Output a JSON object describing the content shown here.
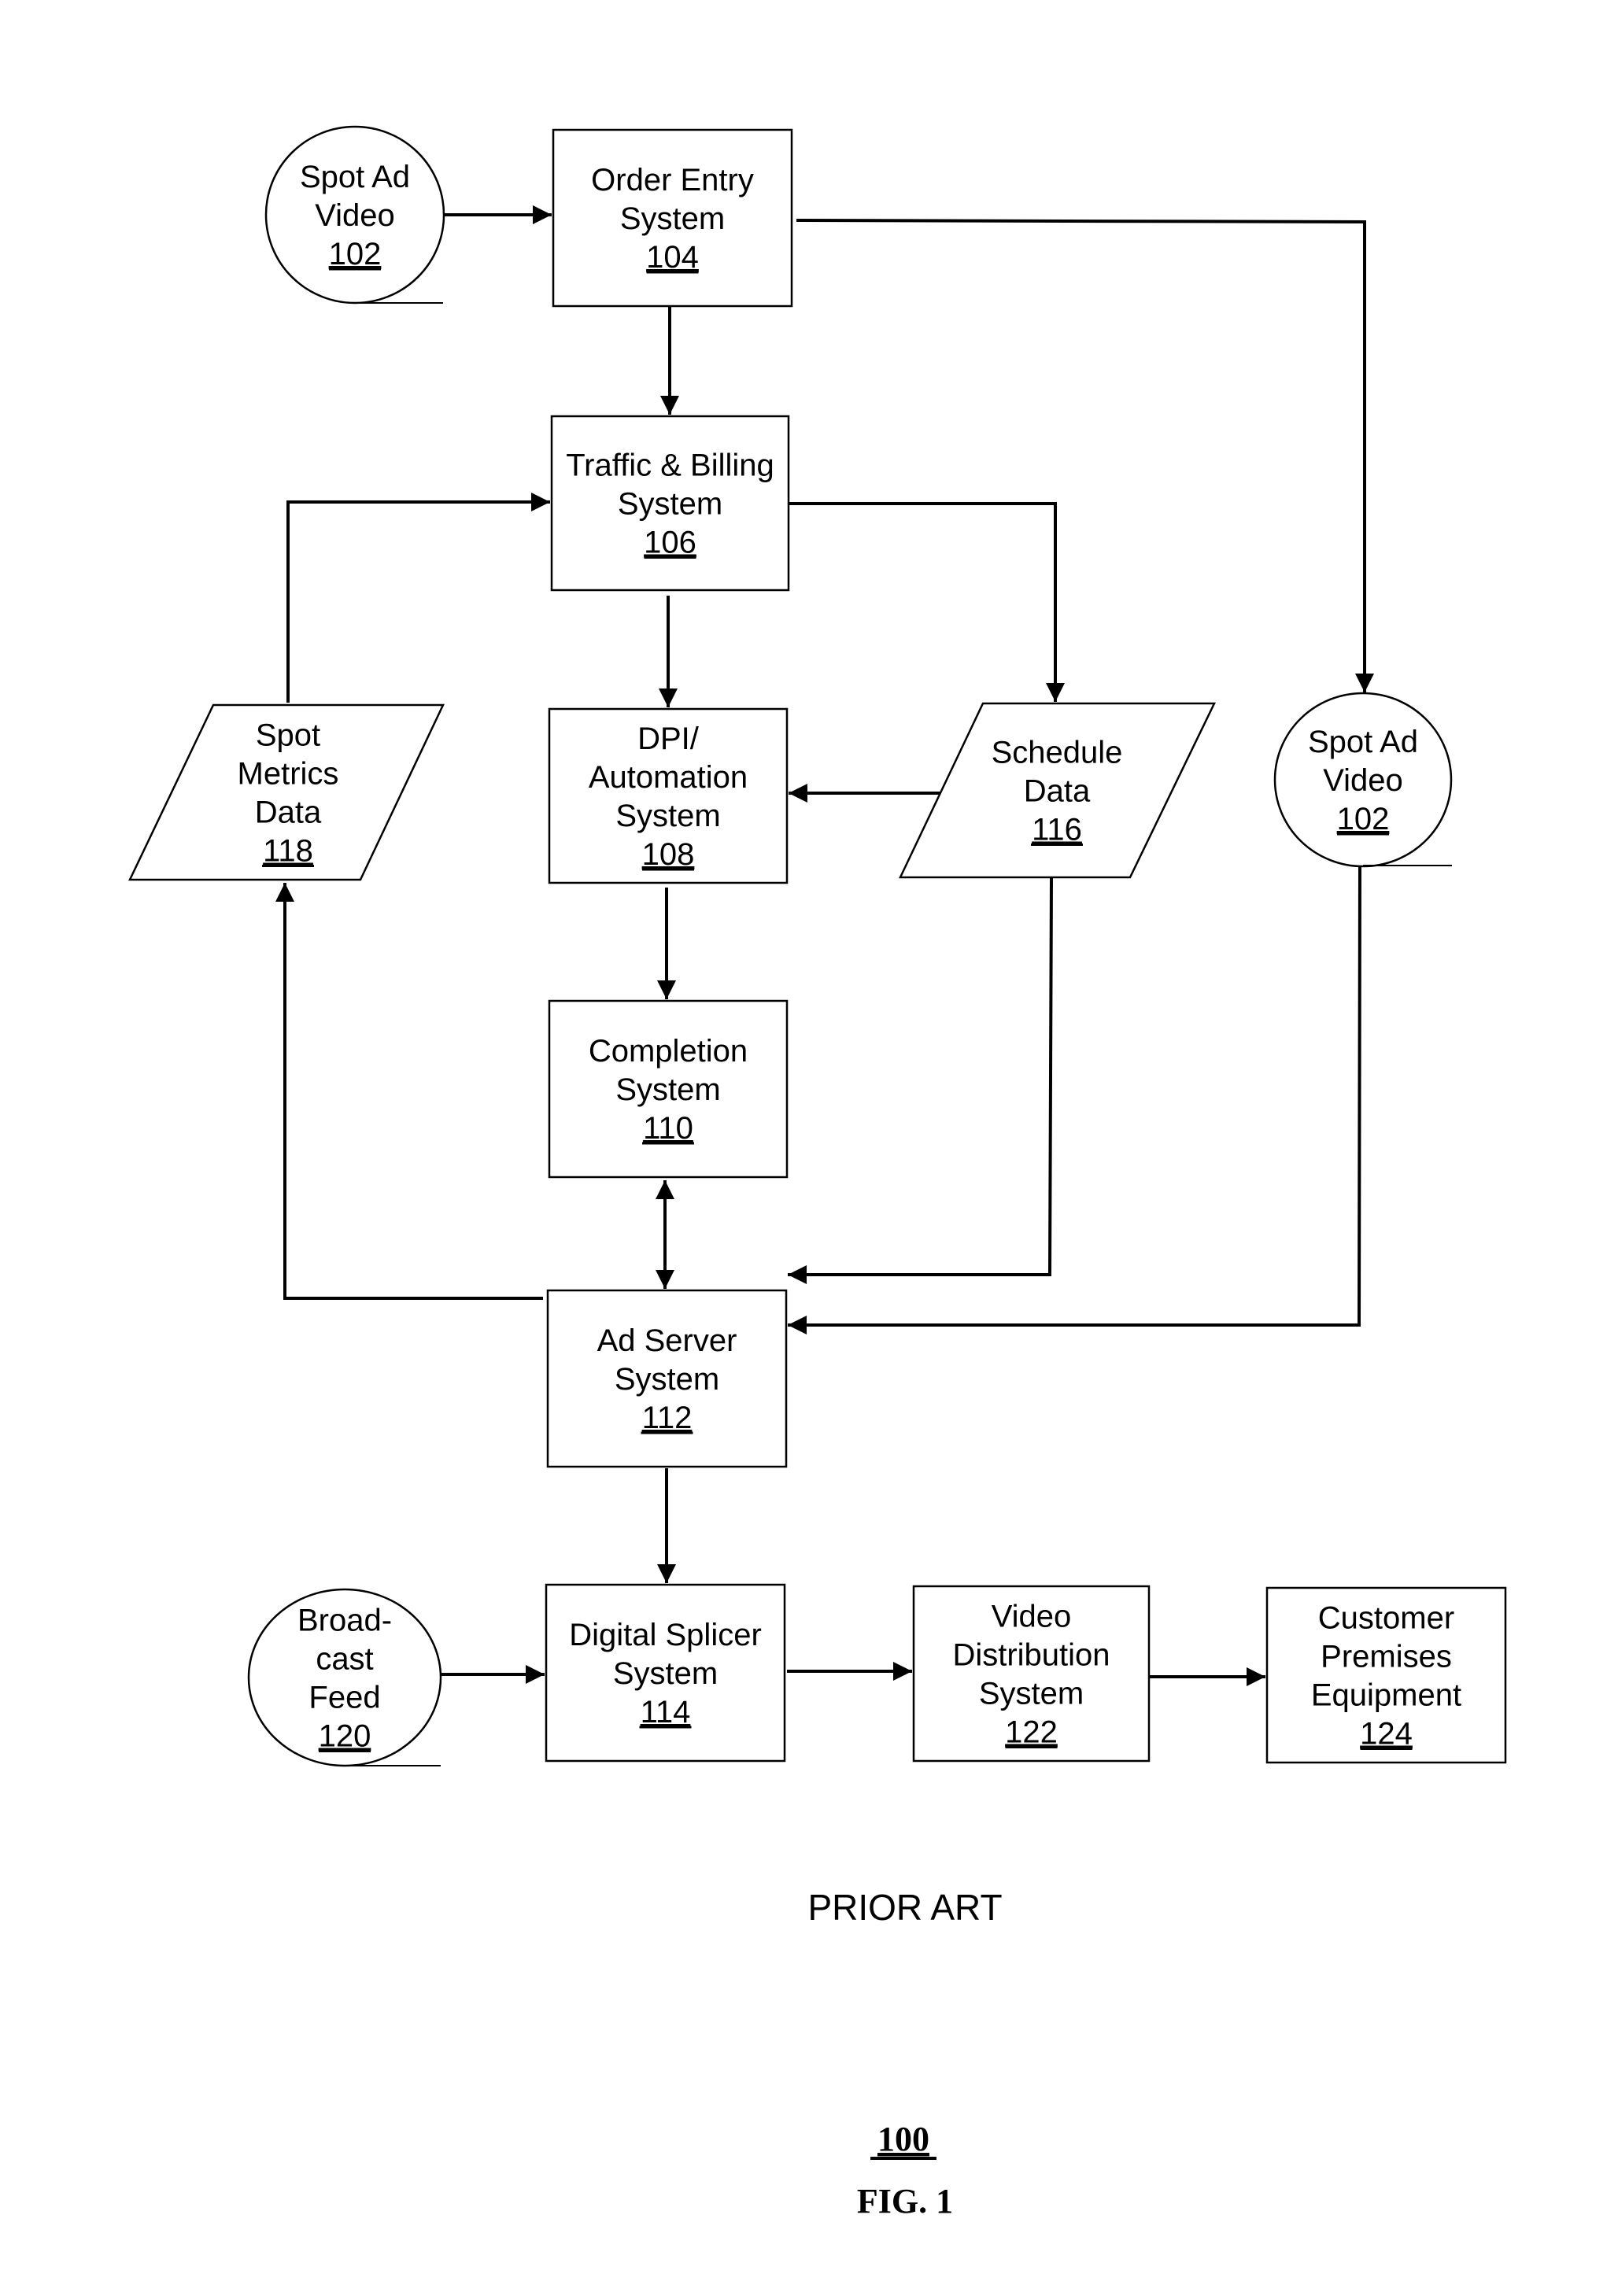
{
  "figure": {
    "caption": "PRIOR ART",
    "number": "100",
    "label": "FIG. 1"
  },
  "nodes": [
    {
      "id": "102a",
      "shape": "circle",
      "lines": [
        "Spot Ad",
        "Video"
      ],
      "ref": "102"
    },
    {
      "id": "104",
      "shape": "box",
      "lines": [
        "Order Entry",
        "System"
      ],
      "ref": "104"
    },
    {
      "id": "106",
      "shape": "box",
      "lines": [
        "Traffic & Billing",
        "System"
      ],
      "ref": "106"
    },
    {
      "id": "108",
      "shape": "box",
      "lines": [
        "DPI/",
        "Automation",
        "System"
      ],
      "ref": "108"
    },
    {
      "id": "110",
      "shape": "box",
      "lines": [
        "Completion",
        "System"
      ],
      "ref": "110"
    },
    {
      "id": "112",
      "shape": "box",
      "lines": [
        "Ad Server",
        "System"
      ],
      "ref": "112"
    },
    {
      "id": "114",
      "shape": "box",
      "lines": [
        "Digital Splicer",
        "System"
      ],
      "ref": "114"
    },
    {
      "id": "116",
      "shape": "parallelogram",
      "lines": [
        "Schedule",
        "Data"
      ],
      "ref": "116"
    },
    {
      "id": "118",
      "shape": "parallelogram",
      "lines": [
        "Spot",
        "Metrics",
        "Data"
      ],
      "ref": "118"
    },
    {
      "id": "102b",
      "shape": "circle",
      "lines": [
        "Spot Ad",
        "Video"
      ],
      "ref": "102"
    },
    {
      "id": "120",
      "shape": "circle",
      "lines": [
        "Broad-",
        "cast",
        "Feed"
      ],
      "ref": "120"
    },
    {
      "id": "122",
      "shape": "box",
      "lines": [
        "Video",
        "Distribution",
        "System"
      ],
      "ref": "122"
    },
    {
      "id": "124",
      "shape": "box",
      "lines": [
        "Customer",
        "Premises",
        "Equipment"
      ],
      "ref": "124"
    }
  ],
  "edges": [
    {
      "from": "102a",
      "to": "104",
      "direction": "forward"
    },
    {
      "from": "104",
      "to": "106",
      "direction": "forward"
    },
    {
      "from": "104",
      "to": "102b",
      "direction": "forward"
    },
    {
      "from": "106",
      "to": "108",
      "direction": "forward"
    },
    {
      "from": "106",
      "to": "116",
      "direction": "forward"
    },
    {
      "from": "118",
      "to": "106",
      "direction": "forward"
    },
    {
      "from": "116",
      "to": "108",
      "direction": "forward"
    },
    {
      "from": "108",
      "to": "110",
      "direction": "forward"
    },
    {
      "from": "110",
      "to": "112",
      "direction": "bidirectional"
    },
    {
      "from": "116",
      "to": "112",
      "direction": "forward"
    },
    {
      "from": "102b",
      "to": "112",
      "direction": "forward"
    },
    {
      "from": "112",
      "to": "118",
      "direction": "forward"
    },
    {
      "from": "112",
      "to": "114",
      "direction": "forward"
    },
    {
      "from": "120",
      "to": "114",
      "direction": "forward"
    },
    {
      "from": "114",
      "to": "122",
      "direction": "forward"
    },
    {
      "from": "122",
      "to": "124",
      "direction": "forward"
    }
  ]
}
